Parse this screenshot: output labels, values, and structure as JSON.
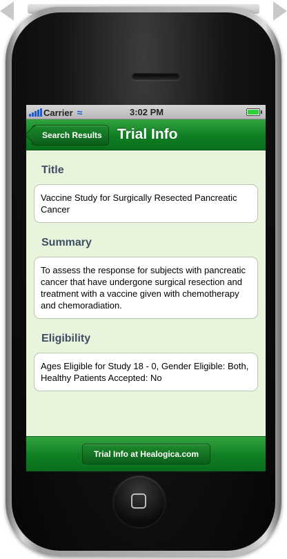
{
  "status_bar": {
    "carrier": "Carrier",
    "time": "3:02 PM",
    "signal_icon": "signal-bars-icon",
    "wifi_icon": "wifi-icon",
    "battery_icon": "battery-icon"
  },
  "nav_bar": {
    "back_label": "Search Results",
    "title": "Trial Info"
  },
  "sections": {
    "title": {
      "heading": "Title",
      "text": "Vaccine Study for Surgically Resected Pancreatic Cancer"
    },
    "summary": {
      "heading": "Summary",
      "text": "To assess the response for subjects with pancreatic cancer that have undergone surgical resection and treatment with a vaccine given with chemotherapy and chemoradiation."
    },
    "eligibility": {
      "heading": "Eligibility",
      "text": "Ages Eligible for Study 18 - 0, Gender Eligible: Both, Healthy Patients Accepted: No"
    }
  },
  "bottom_bar": {
    "link_label": "Trial Info at Healogica.com"
  },
  "colors": {
    "nav_green": "#0f7e23",
    "content_bg": "#e8f4dc",
    "heading_text": "#3e4e63"
  }
}
